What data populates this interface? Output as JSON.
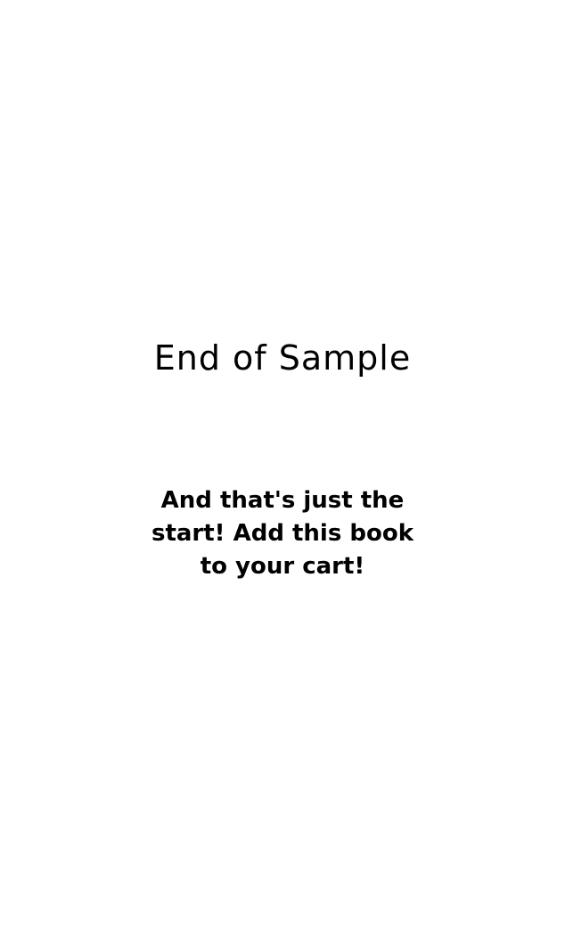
{
  "sample": {
    "title": "End of Sample",
    "message": "And that's just the start! Add this book to your cart!"
  },
  "colors": {
    "background": "#ffffff",
    "text": "#000000"
  }
}
